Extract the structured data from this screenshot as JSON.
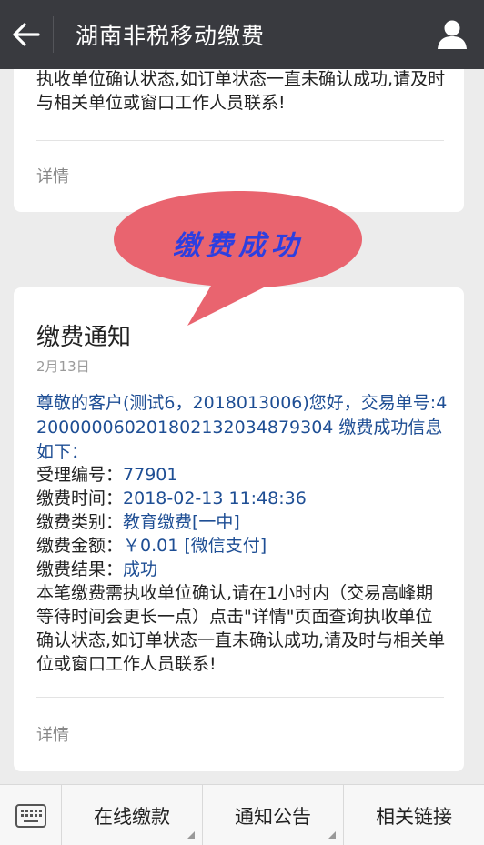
{
  "header": {
    "title": "湖南非税移动缴费",
    "back_icon": "back-arrow-icon",
    "user_icon": "user-icon"
  },
  "message_prev": {
    "text_tail": "执收单位确认状态,如订单状态一直未确认成功,请及时与相关单位或窗口工作人员联系!",
    "details_label": "详情"
  },
  "bubble": {
    "text": "缴费成功",
    "fill_color": "#e9646f",
    "text_color": "#2d3fe0"
  },
  "message": {
    "title": "缴费通知",
    "date": "2月13日",
    "greeting": "尊敬的客户(测试6，2018013006)您好，交易单号:42000000602018021320348793​04 缴费成功信息如下：",
    "rows": [
      {
        "label": "受理编号：",
        "value": "77901"
      },
      {
        "label": "缴费时间：",
        "value": "2018-02-13 11:48:36"
      },
      {
        "label": "缴费类别：",
        "value": "教育缴费[一中]"
      },
      {
        "label": "缴费金额：",
        "value": "￥0.01  [微信支付]"
      },
      {
        "label": "缴费结果：",
        "value": "成功"
      }
    ],
    "note": "本笔缴费需执收单位确认,请在1小时内（交易高峰期等待时间会更长一点）点击\"详情\"页面查询执收单位确认状态,如订单状态一直未确认成功,请及时与相关单位或窗口工作人员联系!",
    "details_label": "详情"
  },
  "menu": {
    "keyboard_icon": "keyboard-icon",
    "items": [
      "在线缴款",
      "通知公告",
      "相关链接"
    ]
  },
  "colors": {
    "topbar": "#393a3f",
    "link_blue": "#1e4e94",
    "background": "#ececec"
  }
}
